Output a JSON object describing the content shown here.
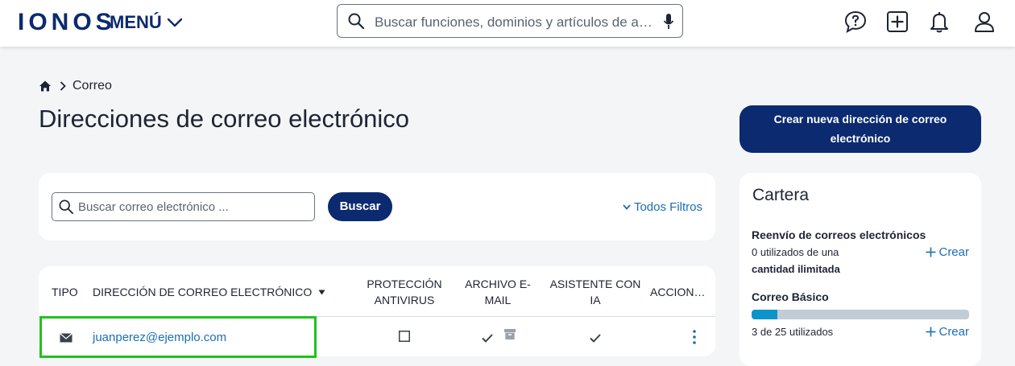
{
  "header": {
    "logo": "IONOS",
    "menu_label": "MENÚ",
    "search_placeholder": "Buscar funciones, dominios y artículos de ayuda",
    "icons": [
      "help-chat-icon",
      "add-icon",
      "bell-icon",
      "user-icon"
    ]
  },
  "breadcrumb": {
    "home_icon": "home-icon",
    "current": "Correo"
  },
  "page_title": "Direcciones de correo electrónico",
  "create_button": "Crear nueva dirección de correo electrónico",
  "filter_bar": {
    "search_placeholder": "Buscar correo electrónico ...",
    "search_button": "Buscar",
    "filters_link": "Todos Filtros"
  },
  "table": {
    "headers": {
      "tipo": "TIPO",
      "direccion": "DIRECCIÓN DE CORREO ELECTRÓNICO",
      "proteccion_1": "PROTECCIÓN",
      "proteccion_2": "ANTIVIRUS",
      "archivo_1": "ARCHIVO E-",
      "archivo_2": "MAIL",
      "asistente_1": "ASISTENTE CON",
      "asistente_2": "IA",
      "acciones": "ACCION…"
    },
    "rows": [
      {
        "type_icon": "envelope-icon",
        "email": "juanperez@ejemplo.com",
        "antivirus": false,
        "archive": true,
        "assistant": true
      }
    ]
  },
  "cartera": {
    "title": "Cartera",
    "reenvio": {
      "label": "Reenvío de correos electrónicos",
      "usage_line1": "0 utilizados de una",
      "usage_line2": "cantidad ilimitada",
      "create": "Crear"
    },
    "basico": {
      "label": "Correo Básico",
      "used": 3,
      "total": 25,
      "usage_text": "3 de 25 utilizados",
      "create": "Crear"
    }
  },
  "colors": {
    "brand": "#0b2a6f",
    "link": "#1a6fb3",
    "highlight": "#22c11e",
    "progress": "#0a94c8"
  }
}
